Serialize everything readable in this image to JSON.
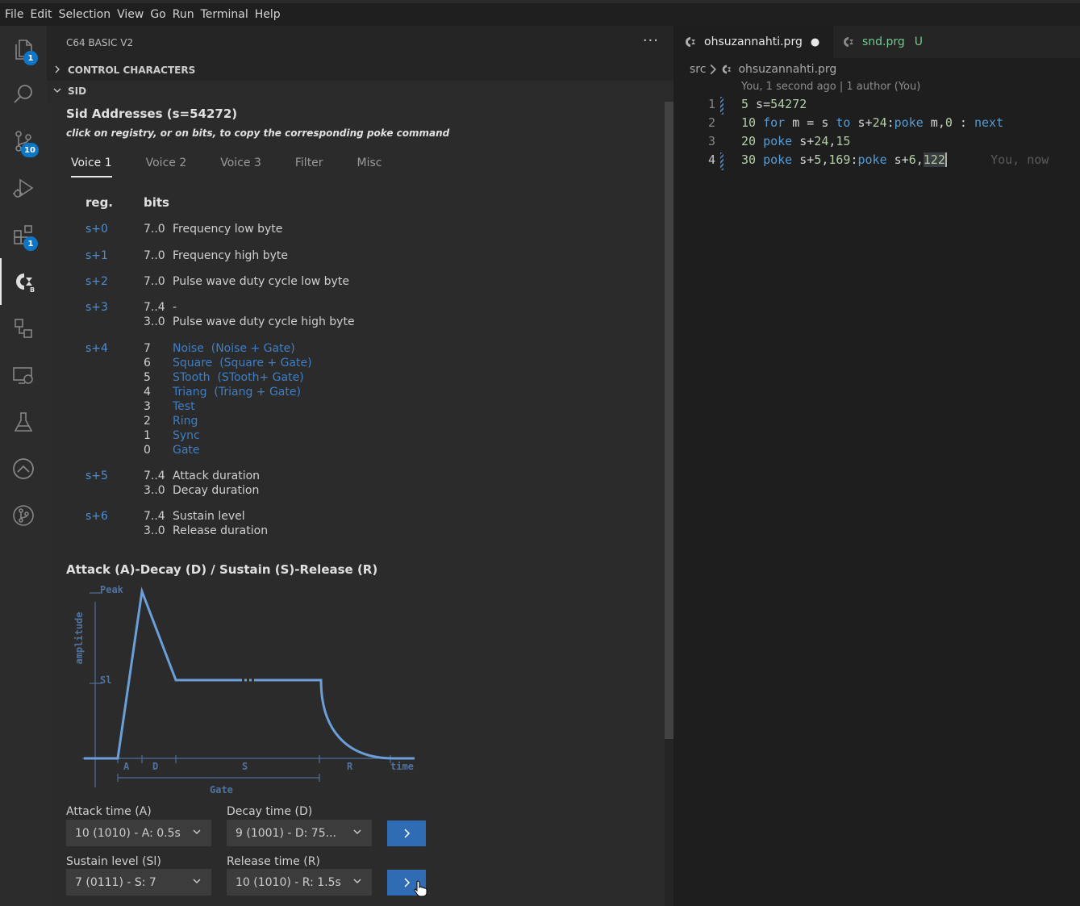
{
  "menubar": {
    "items": [
      "File",
      "Edit",
      "Selection",
      "View",
      "Go",
      "Run",
      "Terminal",
      "Help"
    ]
  },
  "activity_bar": {
    "items": [
      {
        "name": "explorer",
        "icon": "files-icon",
        "badge": "1"
      },
      {
        "name": "search",
        "icon": "search-icon",
        "badge": ""
      },
      {
        "name": "source-control",
        "icon": "source-control-icon",
        "badge": "10"
      },
      {
        "name": "run-debug",
        "icon": "run-debug-icon",
        "badge": ""
      },
      {
        "name": "extensions",
        "icon": "extensions-icon",
        "badge": "1"
      },
      {
        "name": "c64-basic",
        "icon": "c64-logo-icon",
        "badge": ""
      },
      {
        "name": "remote",
        "icon": "remote-explorer-icon",
        "badge": ""
      },
      {
        "name": "remote-window",
        "icon": "remote-window-icon",
        "badge": ""
      },
      {
        "name": "testing",
        "icon": "flask-icon",
        "badge": ""
      },
      {
        "name": "upload",
        "icon": "upload-circle-icon",
        "badge": ""
      },
      {
        "name": "git-graph",
        "icon": "git-graph-icon",
        "badge": ""
      }
    ]
  },
  "sidebar": {
    "title": "C64 BASIC V2",
    "more": "···",
    "sections": {
      "control": "CONTROL CHARACTERS",
      "sid": "SID"
    }
  },
  "sid": {
    "title": "Sid Addresses (s=54272)",
    "hint": "click on registry, or on bits, to copy the corresponding poke command",
    "tabs": [
      "Voice 1",
      "Voice 2",
      "Voice 3",
      "Filter",
      "Misc"
    ],
    "headers": {
      "reg": "reg.",
      "bits": "bits"
    },
    "registers": [
      {
        "reg": "s+0",
        "rows": [
          {
            "bits": "7..0",
            "desc": "Frequency low byte",
            "link": false
          }
        ]
      },
      {
        "reg": "s+1",
        "rows": [
          {
            "bits": "7..0",
            "desc": "Frequency high byte",
            "link": false
          }
        ]
      },
      {
        "reg": "s+2",
        "rows": [
          {
            "bits": "7..0",
            "desc": "Pulse wave duty cycle low byte",
            "link": false
          }
        ]
      },
      {
        "reg": "s+3",
        "rows": [
          {
            "bits": "7..4",
            "desc": "-",
            "link": false
          },
          {
            "bits": "3..0",
            "desc": "Pulse wave duty cycle high byte",
            "link": false
          }
        ]
      },
      {
        "reg": "s+4",
        "rows": [
          {
            "bits": "7",
            "desc": "Noise",
            "desc2": "(Noise + Gate)",
            "link": true
          },
          {
            "bits": "6",
            "desc": "Square",
            "desc2": "(Square + Gate)",
            "link": true
          },
          {
            "bits": "5",
            "desc": "STooth",
            "desc2": "(STooth+ Gate)",
            "link": true
          },
          {
            "bits": "4",
            "desc": "Triang",
            "desc2": "(Triang + Gate)",
            "link": true
          },
          {
            "bits": "3",
            "desc": "Test",
            "link": true
          },
          {
            "bits": "2",
            "desc": "Ring",
            "link": true
          },
          {
            "bits": "1",
            "desc": "Sync",
            "link": true
          },
          {
            "bits": "0",
            "desc": "Gate",
            "link": true
          }
        ]
      },
      {
        "reg": "s+5",
        "rows": [
          {
            "bits": "7..4",
            "desc": "Attack duration",
            "link": false
          },
          {
            "bits": "3..0",
            "desc": "Decay duration",
            "link": false
          }
        ]
      },
      {
        "reg": "s+6",
        "rows": [
          {
            "bits": "7..4",
            "desc": "Sustain level",
            "link": false
          },
          {
            "bits": "3..0",
            "desc": "Release duration",
            "link": false
          }
        ]
      }
    ],
    "adsr": {
      "title": "Attack (A)-Decay (D) / Sustain (S)-Release (R)",
      "diagram_labels": {
        "peak": "Peak",
        "sl": "Sl",
        "amplitude": "amplitude",
        "a": "A",
        "d": "D",
        "s": "S",
        "r": "R",
        "time": "time",
        "gate": "Gate"
      },
      "attack": {
        "label": "Attack time (A)",
        "value": "10 (1010) - A: 0.5s"
      },
      "decay": {
        "label": "Decay time (D)",
        "value": "9 (1001) - D: 75..."
      },
      "sustain": {
        "label": "Sustain level (Sl)",
        "value": "7 (0111) - S: 7"
      },
      "release": {
        "label": "Release time (R)",
        "value": "10 (1010) - R: 1.5s"
      }
    }
  },
  "editor": {
    "tabs": [
      {
        "label": "ohsuzannahti.prg",
        "status": "●",
        "active": true
      },
      {
        "label": "snd.prg",
        "status": "U",
        "active": false
      }
    ],
    "breadcrumb": {
      "folder": "src",
      "file": "ohsuzannahti.prg"
    },
    "blame": "You, 1 second ago | 1 author (You)",
    "line_numbers": [
      "1",
      "2",
      "3",
      "4"
    ],
    "ghost_text": "You, now",
    "colors": {
      "keyword": "#569cd6",
      "number": "#b5cea8",
      "link": "#3f7fc6",
      "accent": "#2f6cb3",
      "modified": "#73c991"
    }
  }
}
